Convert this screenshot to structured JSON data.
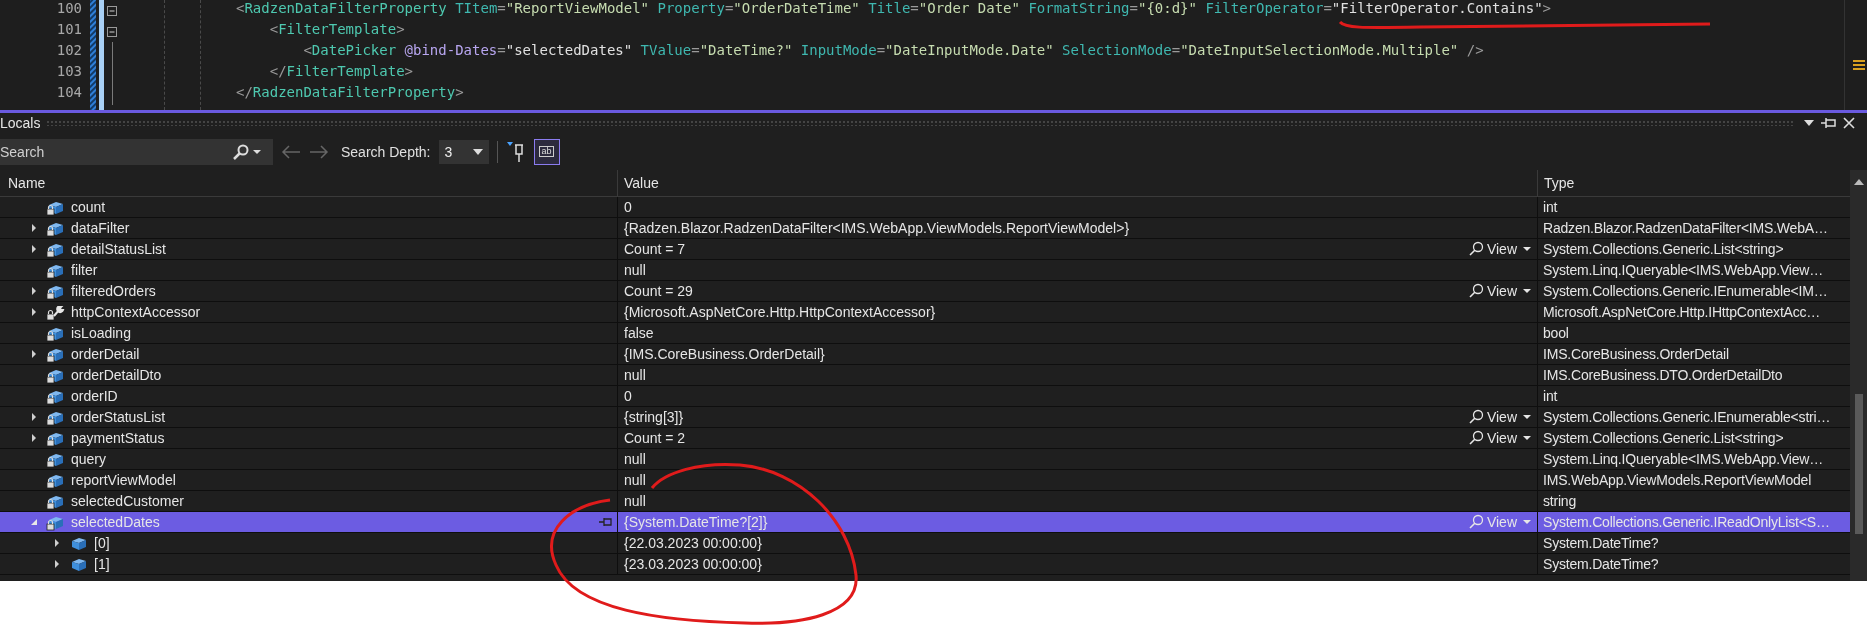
{
  "editor": {
    "lines": [
      {
        "number": "100",
        "fold": true,
        "tokens": [
          {
            "kind": "punct",
            "text": "<"
          },
          {
            "kind": "tag",
            "text": "RadzenDataFilterProperty"
          },
          {
            "kind": "attr",
            "text": " TItem"
          },
          {
            "kind": "punct",
            "text": "="
          },
          {
            "kind": "str",
            "text": "\"ReportViewModel\""
          },
          {
            "kind": "attr",
            "text": " Property"
          },
          {
            "kind": "punct",
            "text": "="
          },
          {
            "kind": "str",
            "text": "\"OrderDateTime\""
          },
          {
            "kind": "attr",
            "text": " Title"
          },
          {
            "kind": "punct",
            "text": "="
          },
          {
            "kind": "str",
            "text": "\"Order Date\""
          },
          {
            "kind": "attr",
            "text": " FormatString"
          },
          {
            "kind": "punct",
            "text": "="
          },
          {
            "kind": "str",
            "text": "\"{0:d}\""
          },
          {
            "kind": "attr",
            "text": " FilterOperator"
          },
          {
            "kind": "punct",
            "text": "="
          },
          {
            "kind": "expr",
            "text": "\"FilterOperator.Contains\""
          },
          {
            "kind": "punct",
            "text": ">"
          }
        ]
      },
      {
        "number": "101",
        "fold": true,
        "tokens": [
          {
            "kind": "punct",
            "text": "    <"
          },
          {
            "kind": "tag",
            "text": "FilterTemplate"
          },
          {
            "kind": "punct",
            "text": ">"
          }
        ]
      },
      {
        "number": "102",
        "fold": false,
        "tokens": [
          {
            "kind": "punct",
            "text": "        <"
          },
          {
            "kind": "tag",
            "text": "DatePicker"
          },
          {
            "kind": "directive",
            "text": " @bind-Dates"
          },
          {
            "kind": "punct",
            "text": "="
          },
          {
            "kind": "expr",
            "text": "\"selectedDates\""
          },
          {
            "kind": "attr",
            "text": " TValue"
          },
          {
            "kind": "punct",
            "text": "="
          },
          {
            "kind": "str",
            "text": "\"DateTime?\""
          },
          {
            "kind": "attr",
            "text": " InputMode"
          },
          {
            "kind": "punct",
            "text": "="
          },
          {
            "kind": "str",
            "text": "\"DateInputMode.Date\""
          },
          {
            "kind": "attr",
            "text": " SelectionMode"
          },
          {
            "kind": "punct",
            "text": "="
          },
          {
            "kind": "str",
            "text": "\"DateInputSelectionMode.Multiple\""
          },
          {
            "kind": "punct",
            "text": " />"
          }
        ]
      },
      {
        "number": "103",
        "fold": false,
        "tokens": [
          {
            "kind": "punct",
            "text": "    </"
          },
          {
            "kind": "tag",
            "text": "FilterTemplate"
          },
          {
            "kind": "punct",
            "text": ">"
          }
        ]
      },
      {
        "number": "104",
        "fold": false,
        "tokens": [
          {
            "kind": "punct",
            "text": "</"
          },
          {
            "kind": "tag",
            "text": "RadzenDataFilterProperty"
          },
          {
            "kind": "punct",
            "text": ">"
          }
        ]
      }
    ]
  },
  "locals": {
    "title": "Locals",
    "toolbar": {
      "search": {
        "placeholder": "Search"
      },
      "depth_label": "Search Depth:",
      "depth_value": "3",
      "hex_toggle": {
        "label": "ab",
        "selected": true
      }
    },
    "columns": [
      "Name",
      "Value",
      "Type"
    ],
    "rows": [
      {
        "kind": "field",
        "name": "count",
        "value": "0",
        "type": "int",
        "selected": false
      },
      {
        "kind": "field",
        "name": "dataFilter",
        "value": "{Radzen.Blazor.RadzenDataFilter<IMS.WebApp.ViewModels.ReportViewModel>}",
        "type": "Radzen.Blazor.RadzenDataFilter<IMS.WebA…",
        "expanded": false,
        "selected": false
      },
      {
        "kind": "field",
        "name": "detailStatusList",
        "value": "Count = 7",
        "view": "View",
        "type": "System.Collections.Generic.List<string>",
        "expanded": false,
        "selected": false
      },
      {
        "kind": "field",
        "name": "filter",
        "value": "null",
        "type": "System.Linq.IQueryable<IMS.WebApp.View…",
        "selected": false
      },
      {
        "kind": "field",
        "name": "filteredOrders",
        "value": "Count = 29",
        "view": "View",
        "type": "System.Collections.Generic.IEnumerable<IM…",
        "expanded": false,
        "selected": false
      },
      {
        "kind": "property",
        "name": "httpContextAccessor",
        "value": "{Microsoft.AspNetCore.Http.HttpContextAccessor}",
        "type": "Microsoft.AspNetCore.Http.IHttpContextAcc…",
        "expanded": false,
        "selected": false
      },
      {
        "kind": "field",
        "name": "isLoading",
        "value": "false",
        "type": "bool",
        "selected": false
      },
      {
        "kind": "field",
        "name": "orderDetail",
        "value": "{IMS.CoreBusiness.OrderDetail}",
        "type": "IMS.CoreBusiness.OrderDetail",
        "expanded": false,
        "selected": false
      },
      {
        "kind": "field",
        "name": "orderDetailDto",
        "value": "null",
        "type": "IMS.CoreBusiness.DTO.OrderDetailDto",
        "selected": false
      },
      {
        "kind": "field",
        "name": "orderID",
        "value": "0",
        "type": "int",
        "selected": false
      },
      {
        "kind": "field",
        "name": "orderStatusList",
        "value": "{string[3]}",
        "view": "View",
        "type": "System.Collections.Generic.IEnumerable<stri…",
        "expanded": false,
        "selected": false
      },
      {
        "kind": "field",
        "name": "paymentStatus",
        "value": "Count = 2",
        "view": "View",
        "type": "System.Collections.Generic.List<string>",
        "expanded": false,
        "selected": false
      },
      {
        "kind": "field",
        "name": "query",
        "value": "null",
        "type": "System.Linq.IQueryable<IMS.WebApp.View…",
        "selected": false
      },
      {
        "kind": "field",
        "name": "reportViewModel",
        "value": "null",
        "type": "IMS.WebApp.ViewModels.ReportViewModel",
        "selected": false
      },
      {
        "kind": "field",
        "name": "selectedCustomer",
        "value": "null",
        "type": "string",
        "selected": false
      },
      {
        "kind": "field",
        "name": "selectedDates",
        "value": "{System.DateTime?[2]}",
        "view": "View",
        "type": "System.Collections.Generic.IReadOnlyList<S…",
        "expanded": true,
        "selected": true,
        "children": [
          {
            "kind": "item",
            "name": "[0]",
            "value": "{22.03.2023 00:00:00}",
            "type": "System.DateTime?",
            "expanded": false,
            "selected": false
          },
          {
            "kind": "item",
            "name": "[1]",
            "value": "{23.03.2023 00:00:00}",
            "type": "System.DateTime?",
            "expanded": false,
            "selected": false
          }
        ]
      }
    ]
  }
}
